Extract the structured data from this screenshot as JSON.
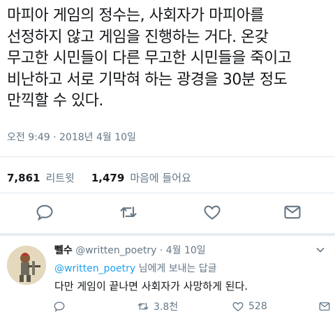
{
  "tweet": {
    "lines": [
      "마피아 게임의 정수는, 사회자가 마피아를",
      "선정하지 않고 게임을 진행하는 거다. 온갖",
      "무고한 시민들이 다른 무고한 시민들을 죽이고",
      "비난하고 서로 기막혀 하는 광경을 30분 정도",
      "만끽할 수 있다."
    ],
    "timestamp": "오전 9:49 · 2018년 4월 10일"
  },
  "stats": {
    "retweets_count": "7,861",
    "retweets_label": "리트윗",
    "likes_count": "1,479",
    "likes_label": "마음에 들어요"
  },
  "actions": {
    "icons": [
      "reply-icon",
      "retweet-icon",
      "like-icon",
      "direct-message-icon"
    ]
  },
  "reply": {
    "name": "뻴수",
    "handle": "@written_poetry",
    "date": "· 4월 10일",
    "reply_to_mention": "@written_poetry",
    "reply_to_suffix": " 님에게 보내는 답글",
    "text": "다만 게임이 끝나면 사회자가 사망하게 된다.",
    "retweet_count": "3.8천",
    "like_count": "528"
  },
  "colors": {
    "text": "#14171a",
    "muted": "#657786",
    "link": "#1da1f2",
    "divider": "#e1e8ed"
  }
}
